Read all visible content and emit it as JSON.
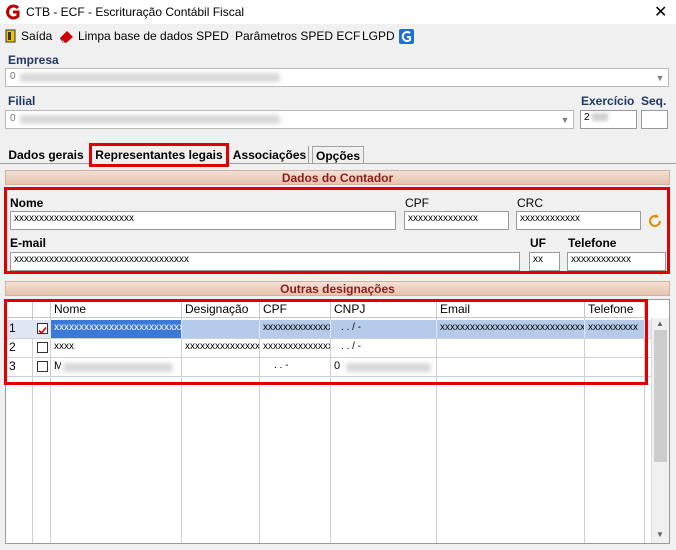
{
  "window": {
    "title": "CTB - ECF - Escrituração Contábil Fiscal",
    "close": "✕"
  },
  "toolbar": {
    "exit": "Saída",
    "clear": "Limpa base de dados SPED",
    "params": "Parâmetros SPED ECF",
    "lgpd": "LGPD"
  },
  "company": {
    "empresa_label": "Empresa",
    "empresa_value": "0",
    "filial_label": "Filial",
    "filial_value": "0",
    "exercicio_label": "Exercício",
    "exercicio_value": "2",
    "seq_label": "Seq."
  },
  "tabs": [
    "Dados gerais",
    "Representantes legais",
    "Associações",
    "Opções"
  ],
  "contador": {
    "header": "Dados do Contador",
    "nome_label": "Nome",
    "nome_value": "xxxxxxxxxxxxxxxxxxxxxxxx",
    "cpf_label": "CPF",
    "cpf_value": "xxxxxxxxxxxxxx",
    "crc_label": "CRC",
    "crc_value": "xxxxxxxxxxxx",
    "email_label": "E-mail",
    "email_value": "xxxxxxxxxxxxxxxxxxxxxxxxxxxxxxxxxxx",
    "uf_label": "UF",
    "uf_value": "xx",
    "telefone_label": "Telefone",
    "telefone_value": "xxxxxxxxxxxx"
  },
  "designacoes": {
    "header": "Outras designações",
    "columns": [
      "Nome",
      "Designação",
      "CPF",
      "CNPJ",
      "Email",
      "Telefone"
    ],
    "rows": [
      {
        "num": "1",
        "checked": true,
        "nome": "xxxxxxxxxxxxxxxxxxxxxxxxxxxx",
        "designacao": "",
        "cpf": "xxxxxxxxxxxxxx",
        "cnpj": ". . / -",
        "email": "xxxxxxxxxxxxxxxxxxxxxxxxxxxxxxxxxxxxxx",
        "telefone": "xxxxxxxxxx"
      },
      {
        "num": "2",
        "checked": false,
        "nome": "xxxx",
        "designacao": "xxxxxxxxxxxxxxxxx",
        "cpf": "xxxxxxxxxxxxxx",
        "cnpj": ". . / -",
        "email": "",
        "telefone": ""
      },
      {
        "num": "3",
        "checked": false,
        "nome": "M",
        "designacao": "",
        "cpf": ". . -",
        "cnpj": "0",
        "email": "",
        "telefone": ""
      }
    ]
  },
  "colors": {
    "accent_red": "#e00000",
    "header_text": "#8c1d1d",
    "label_blue": "#1f3864",
    "selection": "#3b78d8"
  }
}
